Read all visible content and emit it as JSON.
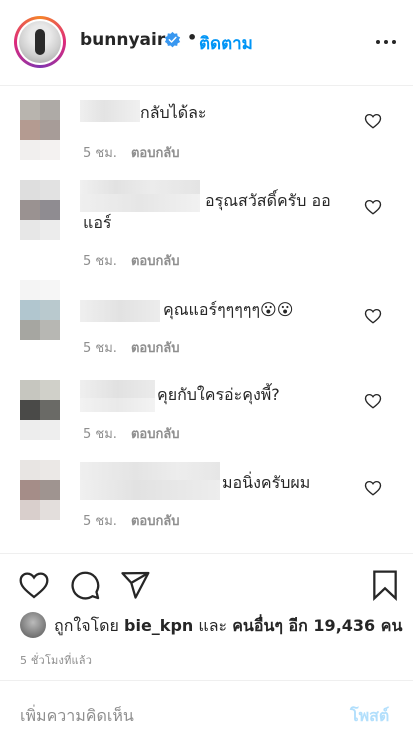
{
  "header": {
    "username": "bunnyaire",
    "separator": "•",
    "follow_label": "ติดตาม",
    "verified_icon": "verified-badge-icon",
    "more_icon": "more-options-icon",
    "accent": "#0095f6"
  },
  "comments": [
    {
      "text": "กลับได้ละ",
      "time": "5 ชม.",
      "reply": "ตอบกลับ"
    },
    {
      "text": "อรุณสวัสดิ์ครับ ออ",
      "text2": "แอร์",
      "time": "5 ชม.",
      "reply": "ตอบกลับ"
    },
    {
      "text": "คุณแอร์ๆๆๆๆๆ😮😮",
      "time": "5 ชม.",
      "reply": "ตอบกลับ"
    },
    {
      "text": "คุยกับใครอ่ะคุงพี้?",
      "time": "5 ชม.",
      "reply": "ตอบกลับ"
    },
    {
      "text": "มอนิ่งครับผม",
      "time": "5 ชม.",
      "reply": "ตอบกลับ"
    }
  ],
  "actions": {
    "like_icon": "heart-icon",
    "comment_icon": "comment-icon",
    "share_icon": "share-icon",
    "save_icon": "bookmark-icon"
  },
  "likes": {
    "prefix": "ถูกใจโดย",
    "user": "bie_kpn",
    "middle": "และ",
    "others": "คนอื่นๆ อีก 19,436 คน"
  },
  "timestamp": "5 ชั่วโมงที่แล้ว",
  "add_comment": {
    "placeholder": "เพิ่มความคิดเห็น",
    "post_label": "โพสต์",
    "post_color": "#b2dffc"
  }
}
